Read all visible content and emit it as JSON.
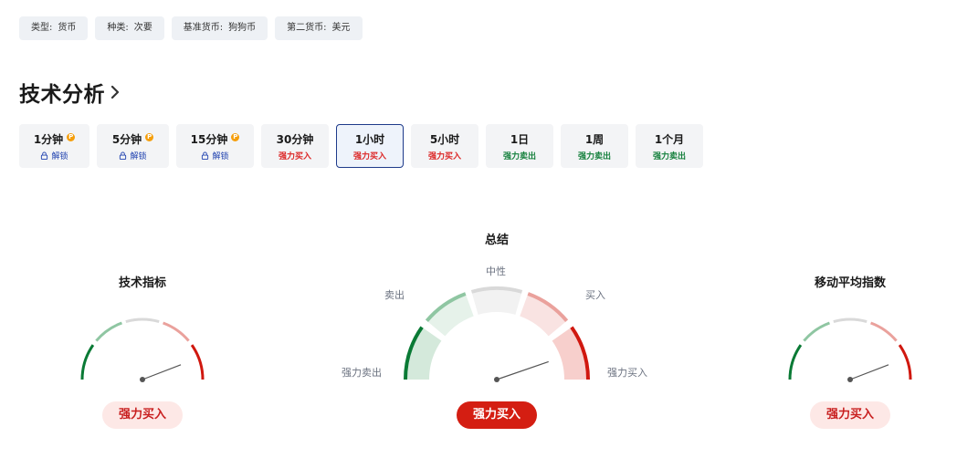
{
  "tags": [
    {
      "label": "类型:",
      "value": "货币"
    },
    {
      "label": "种类:",
      "value": "次要"
    },
    {
      "label": "基准货币:",
      "value": "狗狗币"
    },
    {
      "label": "第二货币:",
      "value": "美元"
    }
  ],
  "heading": {
    "title": "技术分析"
  },
  "intervals": [
    {
      "label": "1分钟",
      "status": "解锁",
      "pro": true,
      "kind": "lock"
    },
    {
      "label": "5分钟",
      "status": "解锁",
      "pro": true,
      "kind": "lock"
    },
    {
      "label": "15分钟",
      "status": "解锁",
      "pro": true,
      "kind": "lock"
    },
    {
      "label": "30分钟",
      "status": "强力买入",
      "pro": false,
      "kind": "buy"
    },
    {
      "label": "1小时",
      "status": "强力买入",
      "pro": false,
      "kind": "buy",
      "selected": true
    },
    {
      "label": "5小时",
      "status": "强力买入",
      "pro": false,
      "kind": "buy"
    },
    {
      "label": "1日",
      "status": "强力卖出",
      "pro": false,
      "kind": "sell"
    },
    {
      "label": "1周",
      "status": "强力卖出",
      "pro": false,
      "kind": "sell"
    },
    {
      "label": "1个月",
      "status": "强力卖出",
      "pro": false,
      "kind": "sell"
    }
  ],
  "pro_badge": "P",
  "summary": {
    "title": "总结",
    "labels": {
      "neutral": "中性",
      "sell": "卖出",
      "buy": "买入",
      "strong_sell": "强力卖出",
      "strong_buy": "强力买入"
    },
    "result": "强力买入"
  },
  "indicators": {
    "title": "技术指标",
    "result": "强力买入"
  },
  "moving_averages": {
    "title": "移动平均指数",
    "result": "强力买入"
  },
  "colors": {
    "strong_sell": "#0a7a35",
    "sell": "#8fc6a2",
    "neutral": "#d9d9d9",
    "buy": "#eaa19c",
    "strong_buy": "#d0180f",
    "buy_text": "#dc2626",
    "sell_text": "#15803d",
    "selected_border": "#1e3a8a"
  }
}
